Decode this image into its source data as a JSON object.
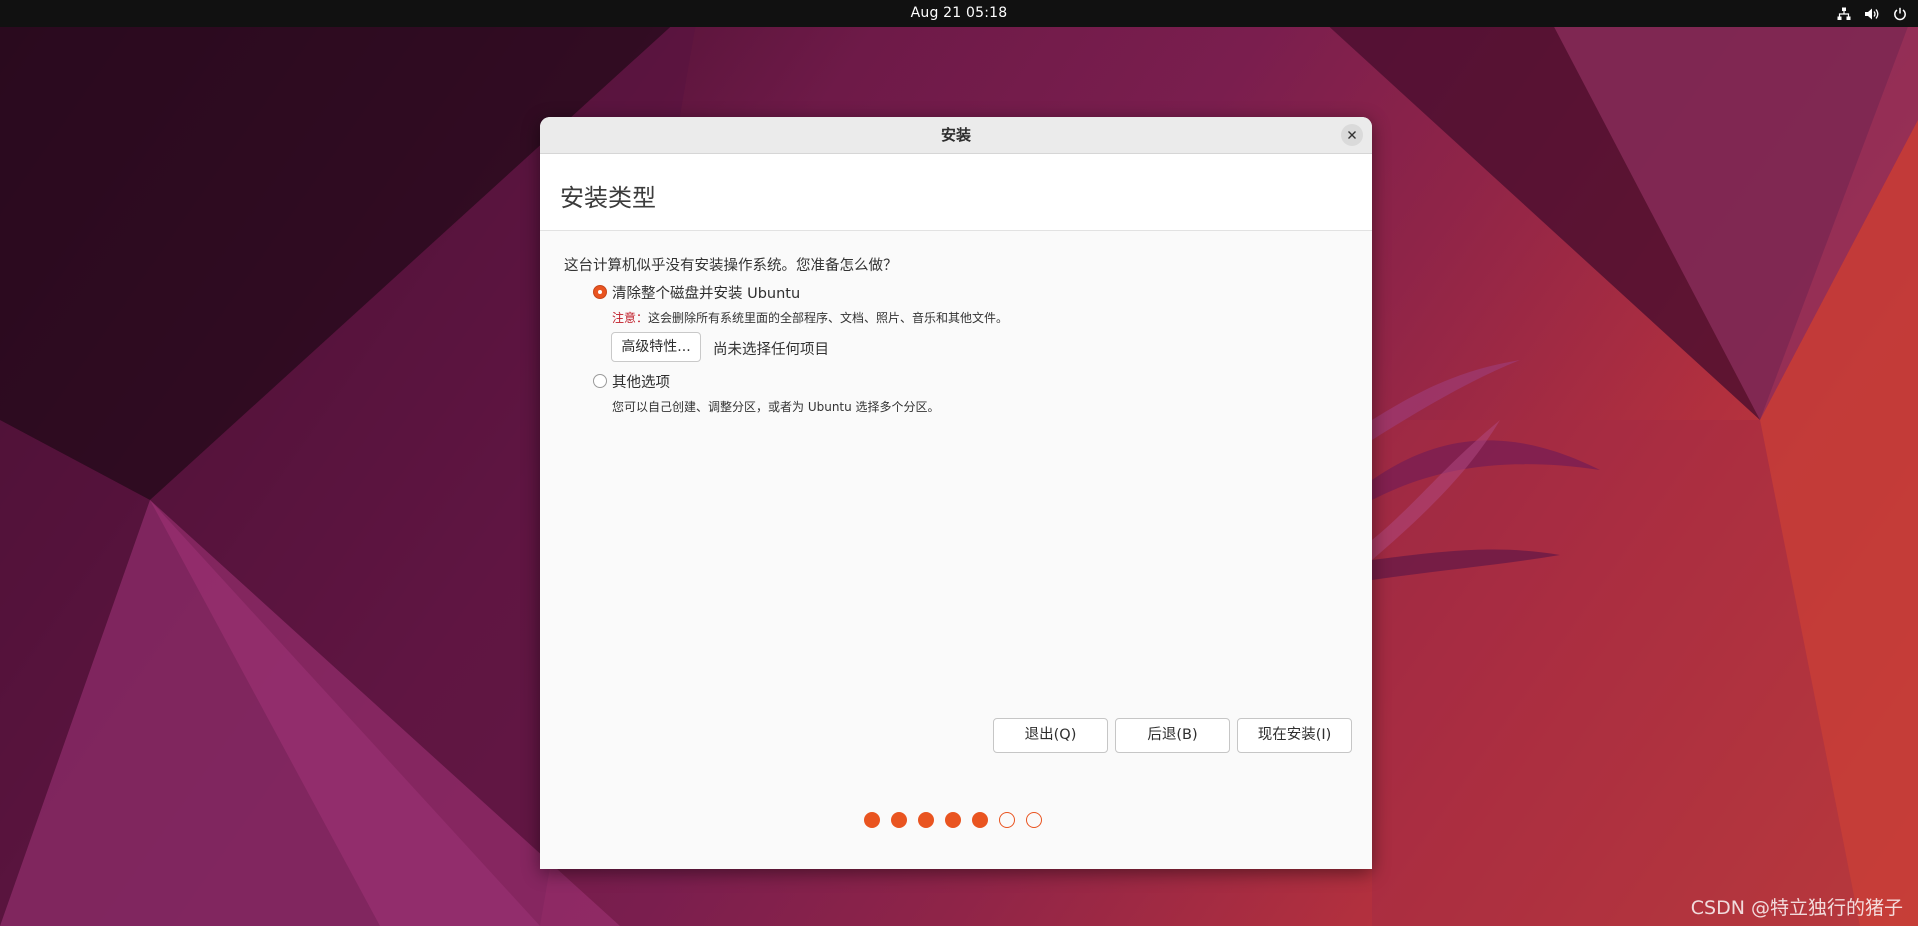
{
  "topbar": {
    "clock": "Aug 21  05:18",
    "tray_icons": [
      "network-icon",
      "volume-icon",
      "power-icon"
    ]
  },
  "window": {
    "title": "安装",
    "heading": "安装类型",
    "question": "这台计算机似乎没有安装操作系统。您准备怎么做？",
    "options": [
      {
        "label": "清除整个磁盘并安装 Ubuntu",
        "selected": true,
        "warning_prefix": "注意：",
        "note": "这会删除所有系统里面的全部程序、文档、照片、音乐和其他文件。"
      },
      {
        "label": "其他选项",
        "selected": false,
        "note": "您可以自己创建、调整分区，或者为 Ubuntu 选择多个分区。"
      }
    ],
    "advanced_button": "高级特性...",
    "advanced_status": "尚未选择任何项目",
    "buttons": {
      "quit": "退出(Q)",
      "back": "后退(B)",
      "install": "现在安装(I)"
    },
    "progress": {
      "current": 5,
      "total": 7
    }
  },
  "colors": {
    "accent": "#e95420",
    "warning": "#c01c28",
    "topbar": "#111111"
  },
  "watermark": "CSDN @特立独行的猪子"
}
